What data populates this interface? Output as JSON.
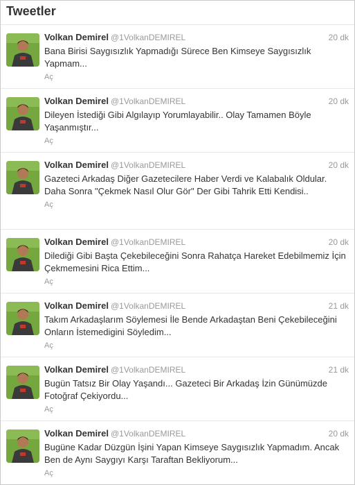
{
  "header": {
    "title": "Tweetler"
  },
  "tweets": [
    {
      "name": "Volkan Demirel",
      "handle": "@1VolkanDEMIREL",
      "time": "20 dk",
      "text": "Bana Birisi Saygısızlık Yapmadığı Sürece Ben Kimseye Saygısızlık Yapmam...",
      "expand": "Aç"
    },
    {
      "name": "Volkan Demirel",
      "handle": "@1VolkanDEMIREL",
      "time": "20 dk",
      "text": "Dileyen İstediği Gibi Algılayıp Yorumlayabilir.. Olay Tamamen Böyle Yaşanmıştır...",
      "expand": "Aç"
    },
    {
      "name": "Volkan Demirel",
      "handle": "@1VolkanDEMIREL",
      "time": "20 dk",
      "text": "Gazeteci Arkadaş Diğer Gazetecilere Haber Verdi ve Kalabalık Oldular. Daha Sonra \"Çekmek Nasıl Olur Gör\" Der Gibi Tahrik Etti Kendisi..",
      "expand": "Aç"
    },
    {
      "name": "Volkan Demirel",
      "handle": "@1VolkanDEMIREL",
      "time": "20 dk",
      "text": "Dilediği Gibi Başta Çekebileceğini Sonra Rahatça Hareket Edebilmemiz İçin Çekmemesini Rica Ettim...",
      "expand": "Aç"
    },
    {
      "name": "Volkan Demirel",
      "handle": "@1VolkanDEMIREL",
      "time": "21 dk",
      "text": "Takım Arkadaşlarım Söylemesi İle Bende Arkadaştan Beni Çekebileceğini Onların İstemedigini Söyledim...",
      "expand": "Aç"
    },
    {
      "name": "Volkan Demirel",
      "handle": "@1VolkanDEMIREL",
      "time": "21 dk",
      "text": "Bugün Tatsız Bir Olay Yaşandı... Gazeteci Bir Arkadaş İzin Günümüzde Fotoğraf Çekiyordu...",
      "expand": "Aç"
    },
    {
      "name": "Volkan Demirel",
      "handle": "@1VolkanDEMIREL",
      "time": "20 dk",
      "text": "Bugüne Kadar Düzgün İşini Yapan Kimseye Saygısızlık Yapmadım. Ancak Ben de Aynı Saygıyı Karşı Taraftan Bekliyorum...",
      "expand": "Aç"
    }
  ]
}
